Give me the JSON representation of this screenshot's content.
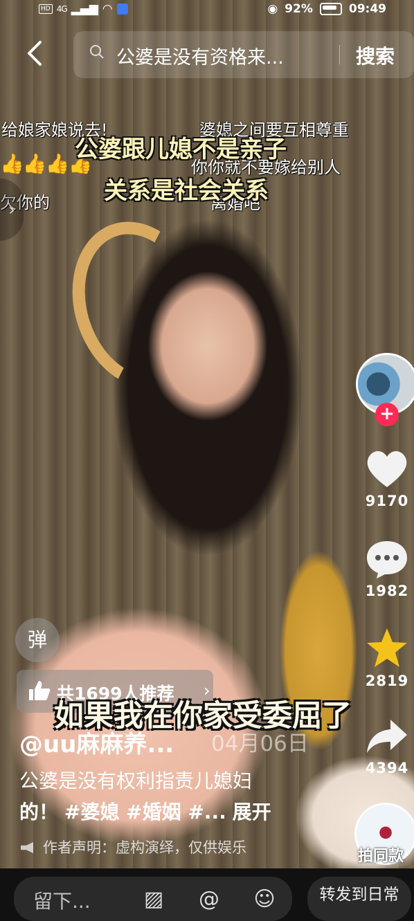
{
  "status_bar": {
    "hd": "HD",
    "network": "4G",
    "battery": "92%",
    "time": "09:49"
  },
  "search": {
    "query": "公婆是没有资格来...",
    "button": "搜索"
  },
  "danmaku": {
    "d1": "给娘家娘说去!",
    "d2": "婆媳之间要互相尊重",
    "d3": "你你就不要嫁给别人",
    "d4": "离婚吧",
    "d5": "欠你的",
    "thumbs": "👍👍👍👍"
  },
  "captions": {
    "line1": "公婆跟儿媳不是亲子",
    "line2": "关系是社会关系",
    "bottom": "如果我在你家受委屈了",
    "date": "04月06日"
  },
  "actions": {
    "likes": "9170",
    "comments": "1982",
    "favorites": "2819",
    "shares": "4394"
  },
  "info": {
    "danmu_toggle": "弹",
    "recommend": "共1699人推荐",
    "author": "@uu麻麻养...",
    "desc_line1": "公婆是没有权利指责儿媳妇",
    "desc_line2_a": "的！",
    "desc_line2_tags": "#婆媳 #婚姻 #...",
    "desc_expand": "展开",
    "disclaimer": "作者声明：虚构演绎，仅供娱乐",
    "same_style": "拍同款"
  },
  "bottom_bar": {
    "comment_placeholder": "留下...",
    "share_daily": "转发到日常"
  },
  "colors": {
    "accent": "#ff2a55",
    "star": "#f4c319",
    "subtitle": "#fff3b8"
  }
}
